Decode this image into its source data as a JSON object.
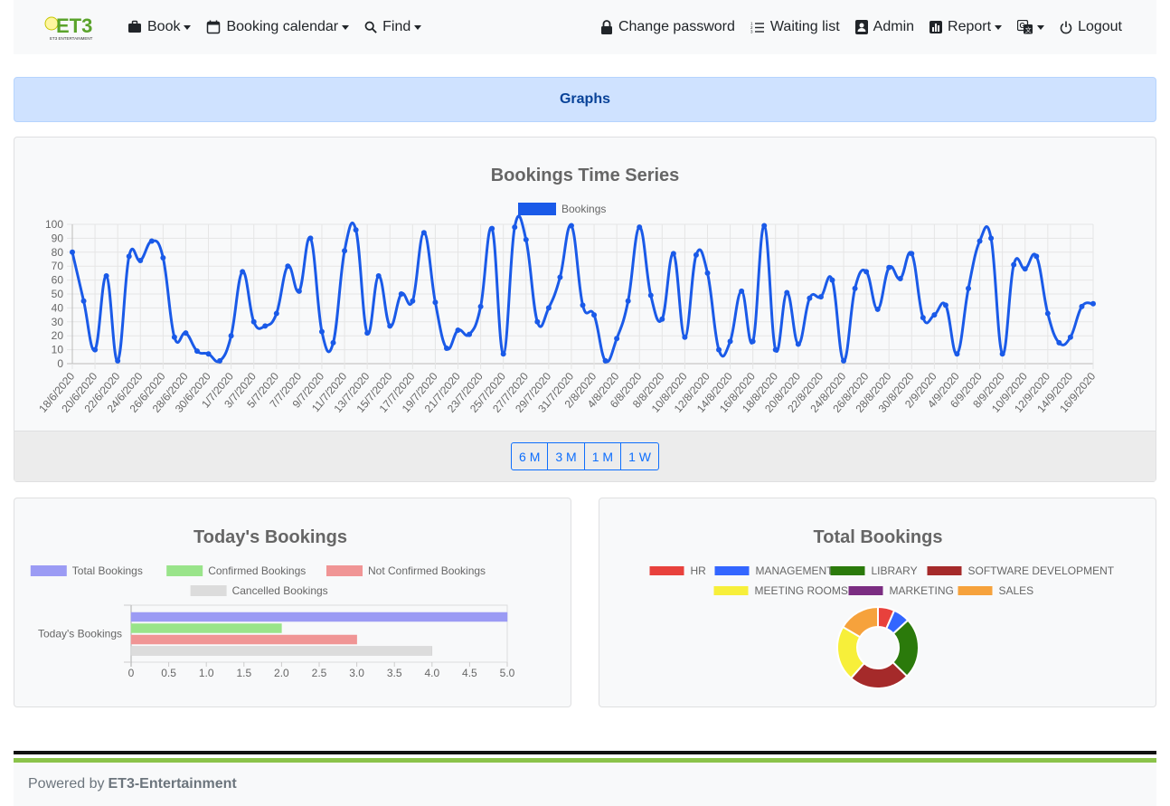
{
  "navbar": {
    "brand": "ET3",
    "brand_sub": "ET3 ENTERTAINMENT",
    "left_items": [
      {
        "label": "Book",
        "icon": "briefcase-icon",
        "dropdown": true
      },
      {
        "label": "Booking calendar",
        "icon": "calendar-icon",
        "dropdown": true
      },
      {
        "label": "Find",
        "icon": "search-icon",
        "dropdown": true
      }
    ],
    "right_items": [
      {
        "label": "Change password",
        "icon": "lock-icon",
        "dropdown": false
      },
      {
        "label": "Waiting list",
        "icon": "list-icon",
        "dropdown": false
      },
      {
        "label": "Admin",
        "icon": "person-badge-icon",
        "dropdown": false
      },
      {
        "label": "Report",
        "icon": "bar-chart-icon",
        "dropdown": true
      },
      {
        "label": "",
        "icon": "translate-icon",
        "dropdown": true
      },
      {
        "label": "Logout",
        "icon": "power-icon",
        "dropdown": false
      }
    ]
  },
  "page": {
    "alert_title": "Graphs"
  },
  "range_buttons": [
    "6 M",
    "3 M",
    "1 M",
    "1 W"
  ],
  "footer": {
    "prefix": "Powered by",
    "company": "ET3-Entertainment"
  },
  "colors": {
    "primary": "#0d6efd",
    "line": "#1a5ae8",
    "footer_green": "#8bc34a"
  },
  "chart_data": [
    {
      "type": "line",
      "title": "Bookings Time Series",
      "legend": [
        "Bookings"
      ],
      "legend_position": "top",
      "ylim": [
        0,
        100
      ],
      "yticks": [
        0,
        10,
        20,
        30,
        40,
        50,
        60,
        70,
        80,
        90,
        100
      ],
      "grid": true,
      "xtick_labels": [
        "18/6/2020",
        "20/6/2020",
        "22/6/2020",
        "24/6/2020",
        "26/6/2020",
        "28/6/2020",
        "30/6/2020",
        "1/7/2020",
        "3/7/2020",
        "5/7/2020",
        "7/7/2020",
        "9/7/2020",
        "11/7/2020",
        "13/7/2020",
        "15/7/2020",
        "17/7/2020",
        "19/7/2020",
        "21/7/2020",
        "23/7/2020",
        "25/7/2020",
        "27/7/2020",
        "29/7/2020",
        "31/7/2020",
        "2/8/2020",
        "4/8/2020",
        "6/8/2020",
        "8/8/2020",
        "10/8/2020",
        "12/8/2020",
        "14/8/2020",
        "16/8/2020",
        "18/8/2020",
        "20/8/2020",
        "22/8/2020",
        "24/8/2020",
        "26/8/2020",
        "28/8/2020",
        "30/8/2020",
        "2/9/2020",
        "4/9/2020",
        "6/9/2020",
        "8/9/2020",
        "10/9/2020",
        "12/9/2020",
        "14/9/2020",
        "16/9/2020"
      ],
      "series": [
        {
          "name": "Bookings",
          "values": [
            80,
            45,
            10,
            63,
            2,
            77,
            74,
            88,
            76,
            19,
            22,
            9,
            7,
            2,
            20,
            66,
            30,
            27,
            36,
            70,
            52,
            90,
            23,
            15,
            81,
            96,
            22,
            63,
            27,
            50,
            45,
            94,
            44,
            11,
            24,
            21,
            41,
            97,
            7,
            98,
            89,
            30,
            40,
            62,
            99,
            42,
            35,
            2,
            18,
            45,
            98,
            49,
            32,
            79,
            19,
            78,
            65,
            10,
            16,
            52,
            16,
            99,
            10,
            51,
            14,
            47,
            48,
            60,
            2,
            54,
            66,
            39,
            69,
            61,
            79,
            33,
            35,
            42,
            7,
            54,
            88,
            90,
            7,
            71,
            68,
            77,
            36,
            15,
            19,
            41,
            43
          ]
        }
      ]
    },
    {
      "type": "bar",
      "orientation": "horizontal",
      "title": "Today's Bookings",
      "categories": [
        "Today's Bookings"
      ],
      "legend_position": "top",
      "xlim": [
        0,
        5.0
      ],
      "xticks": [
        "0",
        "0.5",
        "1.0",
        "1.5",
        "2.0",
        "2.5",
        "3.0",
        "3.5",
        "4.0",
        "4.5",
        "5.0"
      ],
      "series": [
        {
          "name": "Total Bookings",
          "values": [
            5
          ],
          "color": "#9b9bf4"
        },
        {
          "name": "Confirmed Bookings",
          "values": [
            2
          ],
          "color": "#99e48a"
        },
        {
          "name": "Not Confirmed Bookings",
          "values": [
            3
          ],
          "color": "#f09595"
        },
        {
          "name": "Cancelled Bookings",
          "values": [
            4
          ],
          "color": "#dcdcdc"
        }
      ]
    },
    {
      "type": "pie",
      "donut": true,
      "title": "Total Bookings",
      "legend_position": "top",
      "labels": [
        "HR",
        "MANAGEMENT",
        "LIBRARY",
        "SOFTWARE DEVELOPMENT",
        "MEETING ROOMS",
        "MARKETING",
        "SALES"
      ],
      "values": [
        6,
        6,
        22,
        22,
        20,
        0,
        15
      ],
      "colors": [
        "#e8413c",
        "#3366ff",
        "#2b7a0b",
        "#a52a2a",
        "#f7ef3a",
        "#7b2d82",
        "#f6a23c"
      ]
    }
  ]
}
